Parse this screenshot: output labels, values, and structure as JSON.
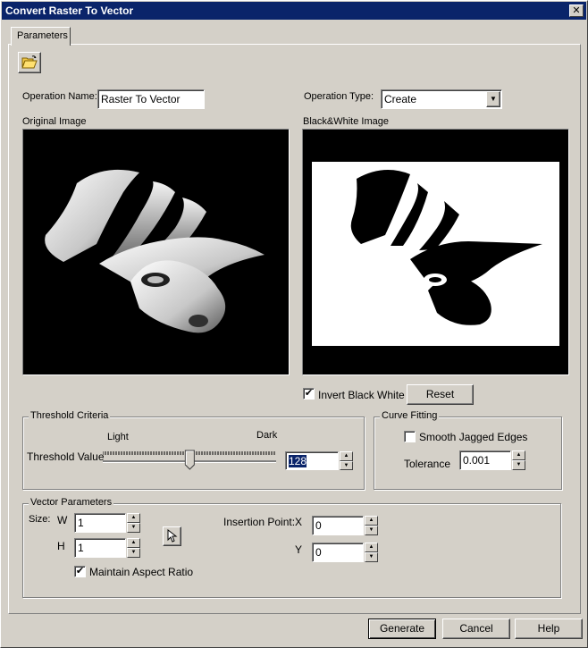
{
  "window": {
    "title": "Convert Raster To Vector",
    "close_glyph": "✕"
  },
  "tabs": [
    {
      "label": "Parameters"
    }
  ],
  "toolbar": {
    "open_icon": "folder-open-icon"
  },
  "operation": {
    "name_label": "Operation Name:",
    "name_value": "Raster To Vector",
    "type_label": "Operation Type:",
    "type_value": "Create",
    "dropdown_glyph": "▼"
  },
  "images": {
    "original_label": "Original Image",
    "bw_label": "Black&White Image"
  },
  "invert": {
    "label": "Invert Black White",
    "checked": "✔"
  },
  "reset_label": "Reset",
  "threshold": {
    "title": "Threshold Criteria",
    "light_label": "Light",
    "dark_label": "Dark",
    "value_label": "Threshold Value",
    "value": "128",
    "max": 255
  },
  "curve": {
    "title": "Curve Fitting",
    "smooth_label": "Smooth Jagged Edges",
    "tolerance_label": "Tolerance",
    "tolerance_value": "0.001"
  },
  "vector": {
    "title": "Vector Parameters",
    "size_label": "Size:",
    "w_label": "W",
    "w_value": "1",
    "h_label": "H",
    "h_value": "1",
    "maintain_label": "Maintain Aspect Ratio",
    "maintain_checked": "✔",
    "insertion_label": "Insertion Point:",
    "x_label": "X",
    "x_value": "0",
    "y_label": "Y",
    "y_value": "0",
    "pick_icon": "cursor-arrow-icon"
  },
  "spin": {
    "up": "▲",
    "down": "▼"
  },
  "footer": {
    "generate_label": "Generate",
    "cancel_label": "Cancel",
    "help_label": "Help"
  },
  "colors": {
    "titlebar": "#0a246a",
    "face": "#d4d0c8",
    "selection": "#0a246a"
  }
}
